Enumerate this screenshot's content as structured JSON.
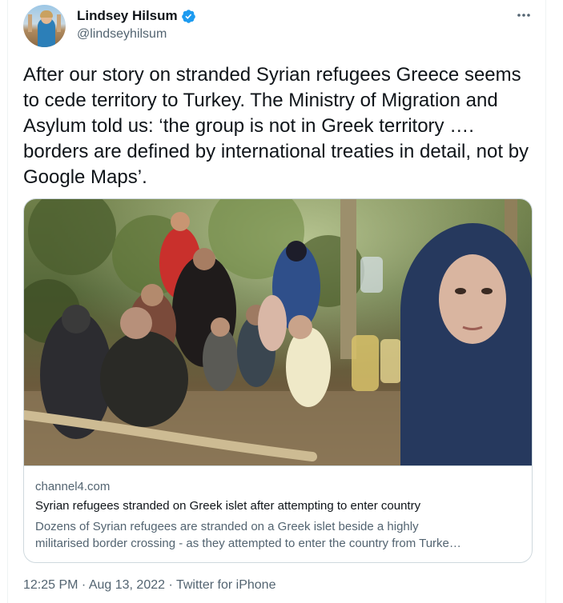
{
  "author": {
    "name": "Lindsey Hilsum",
    "handle": "@lindseyhilsum"
  },
  "icons": {
    "verified": "verified-badge-icon",
    "more": "more-options-icon",
    "verified_color": "#1d9bf0"
  },
  "tweet": {
    "text": "After our story on stranded Syrian refugees Greece seems to cede territory to Turkey. The Ministry of Migration and Asylum told us: ‘the group is not in Greek territory …. borders are defined by international treaties in detail, not by Google Maps’."
  },
  "card": {
    "domain": "channel4.com",
    "title": "Syrian refugees stranded on Greek islet after attempting to enter country",
    "description_line1": "Dozens of Syrian refugees are stranded on a Greek islet beside a highly",
    "description_line2": "militarised border crossing - as they attempted to enter the country from Turke…"
  },
  "meta": {
    "time": "12:25 PM",
    "separator": " · ",
    "date": "Aug 13, 2022",
    "source": "Twitter for iPhone"
  }
}
